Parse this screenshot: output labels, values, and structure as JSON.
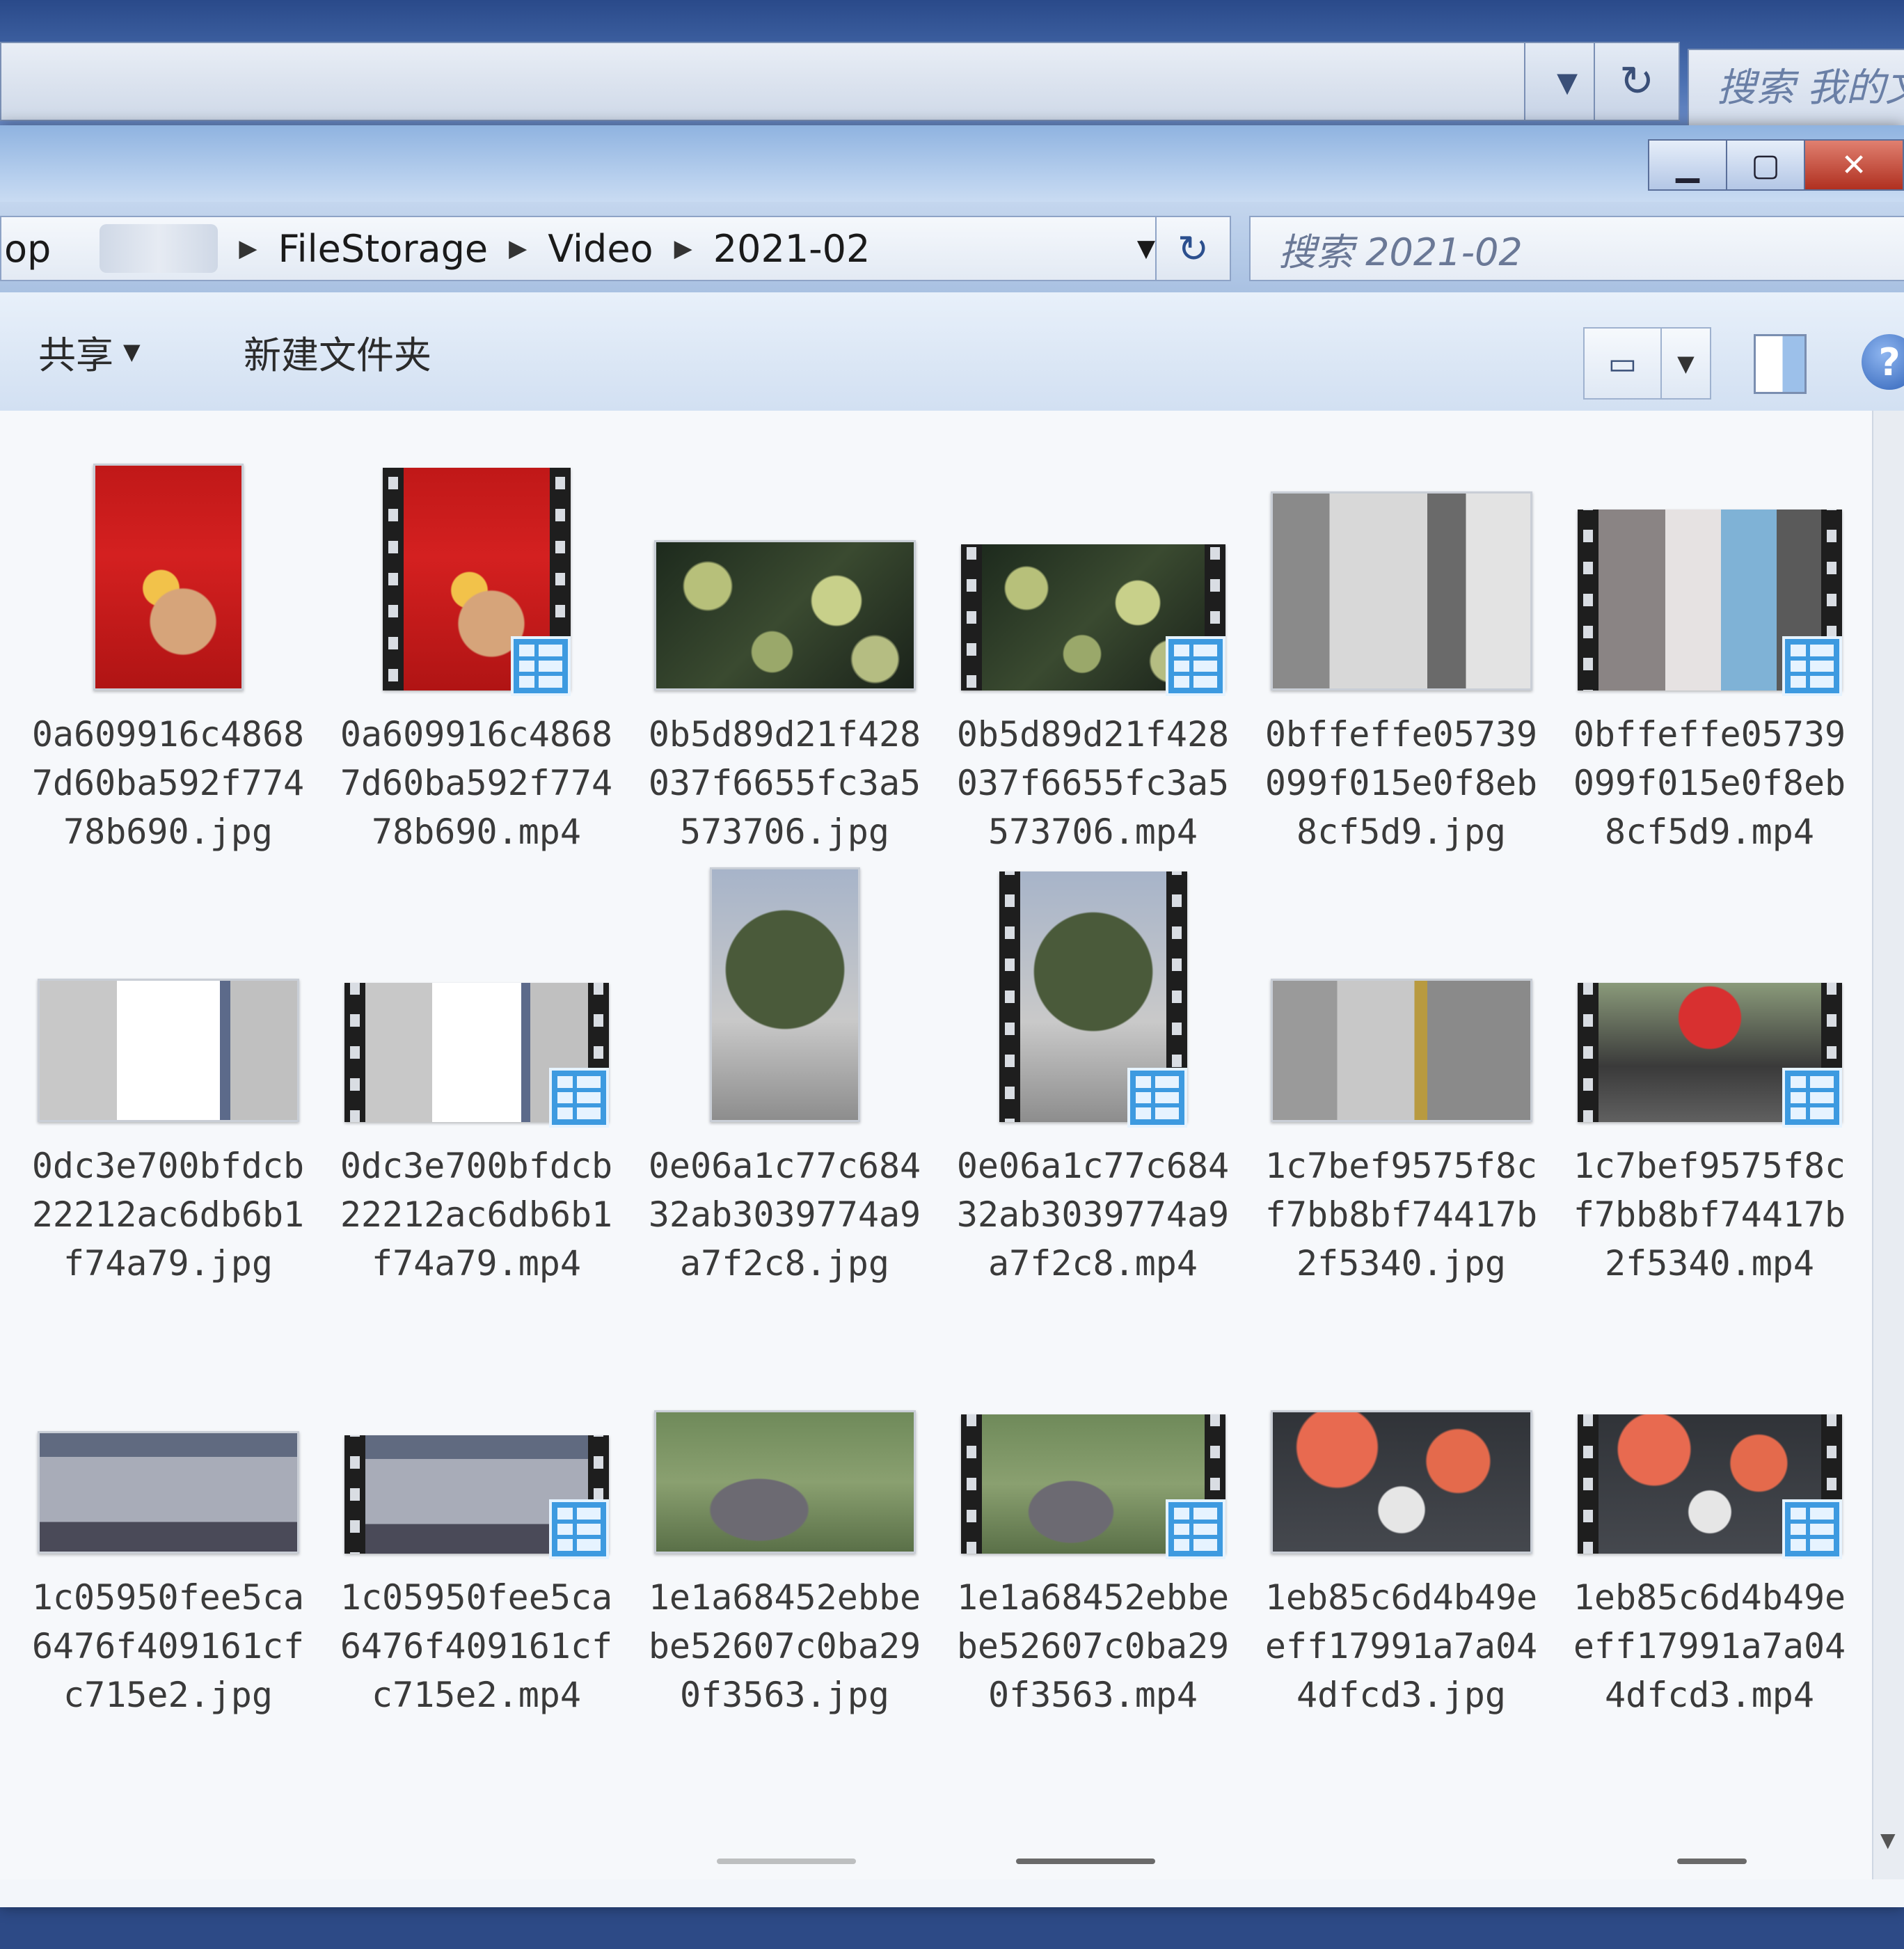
{
  "background_window": {
    "search_placeholder": "搜索 我的文"
  },
  "window": {
    "breadcrumb_fragment": "op",
    "breadcrumb": [
      "FileStorage",
      "Video",
      "2021-02"
    ],
    "search_placeholder": "搜索 2021-02"
  },
  "toolbar": {
    "share_label": "共享",
    "new_folder_label": "新建文件夹",
    "help_label": "?"
  },
  "colors": {
    "titlebar": "#b8d0ee",
    "video_badge": "#3d9ae0"
  },
  "files": [
    {
      "name": "0a609916c48687d60ba592f77478b690.jpg",
      "type": "image",
      "icon": "image-thumbnail"
    },
    {
      "name": "0a609916c48687d60ba592f77478b690.mp4",
      "type": "video",
      "icon": "video-thumbnail"
    },
    {
      "name": "0b5d89d21f428037f6655fc3a5573706.jpg",
      "type": "image",
      "icon": "image-thumbnail"
    },
    {
      "name": "0b5d89d21f428037f6655fc3a5573706.mp4",
      "type": "video",
      "icon": "video-thumbnail"
    },
    {
      "name": "0bffeffe05739099f015e0f8eb8cf5d9.jpg",
      "type": "image",
      "icon": "image-thumbnail"
    },
    {
      "name": "0bffeffe05739099f015e0f8eb8cf5d9.mp4",
      "type": "video",
      "icon": "video-thumbnail"
    },
    {
      "name": "0dc3e700bfdcb22212ac6db6b1f74a79.jpg",
      "type": "image",
      "icon": "image-thumbnail"
    },
    {
      "name": "0dc3e700bfdcb22212ac6db6b1f74a79.mp4",
      "type": "video",
      "icon": "video-thumbnail"
    },
    {
      "name": "0e06a1c77c68432ab3039774a9a7f2c8.jpg",
      "type": "image",
      "icon": "image-thumbnail"
    },
    {
      "name": "0e06a1c77c68432ab3039774a9a7f2c8.mp4",
      "type": "video",
      "icon": "video-thumbnail"
    },
    {
      "name": "1c7bef9575f8cf7bb8bf74417b2f5340.jpg",
      "type": "image",
      "icon": "image-thumbnail"
    },
    {
      "name": "1c7bef9575f8cf7bb8bf74417b2f5340.mp4",
      "type": "video",
      "icon": "video-thumbnail"
    },
    {
      "name": "1c05950fee5ca6476f409161cfc715e2.jpg",
      "type": "image",
      "icon": "image-thumbnail"
    },
    {
      "name": "1c05950fee5ca6476f409161cfc715e2.mp4",
      "type": "video",
      "icon": "video-thumbnail"
    },
    {
      "name": "1e1a68452ebbebe52607c0ba290f3563.jpg",
      "type": "image",
      "icon": "image-thumbnail"
    },
    {
      "name": "1e1a68452ebbebe52607c0ba290f3563.mp4",
      "type": "video",
      "icon": "video-thumbnail"
    },
    {
      "name": "1eb85c6d4b49eeff17991a7a044dfcd3.jpg",
      "type": "image",
      "icon": "image-thumbnail"
    },
    {
      "name": "1eb85c6d4b49eeff17991a7a044dfcd3.mp4",
      "type": "video",
      "icon": "video-thumbnail"
    }
  ]
}
